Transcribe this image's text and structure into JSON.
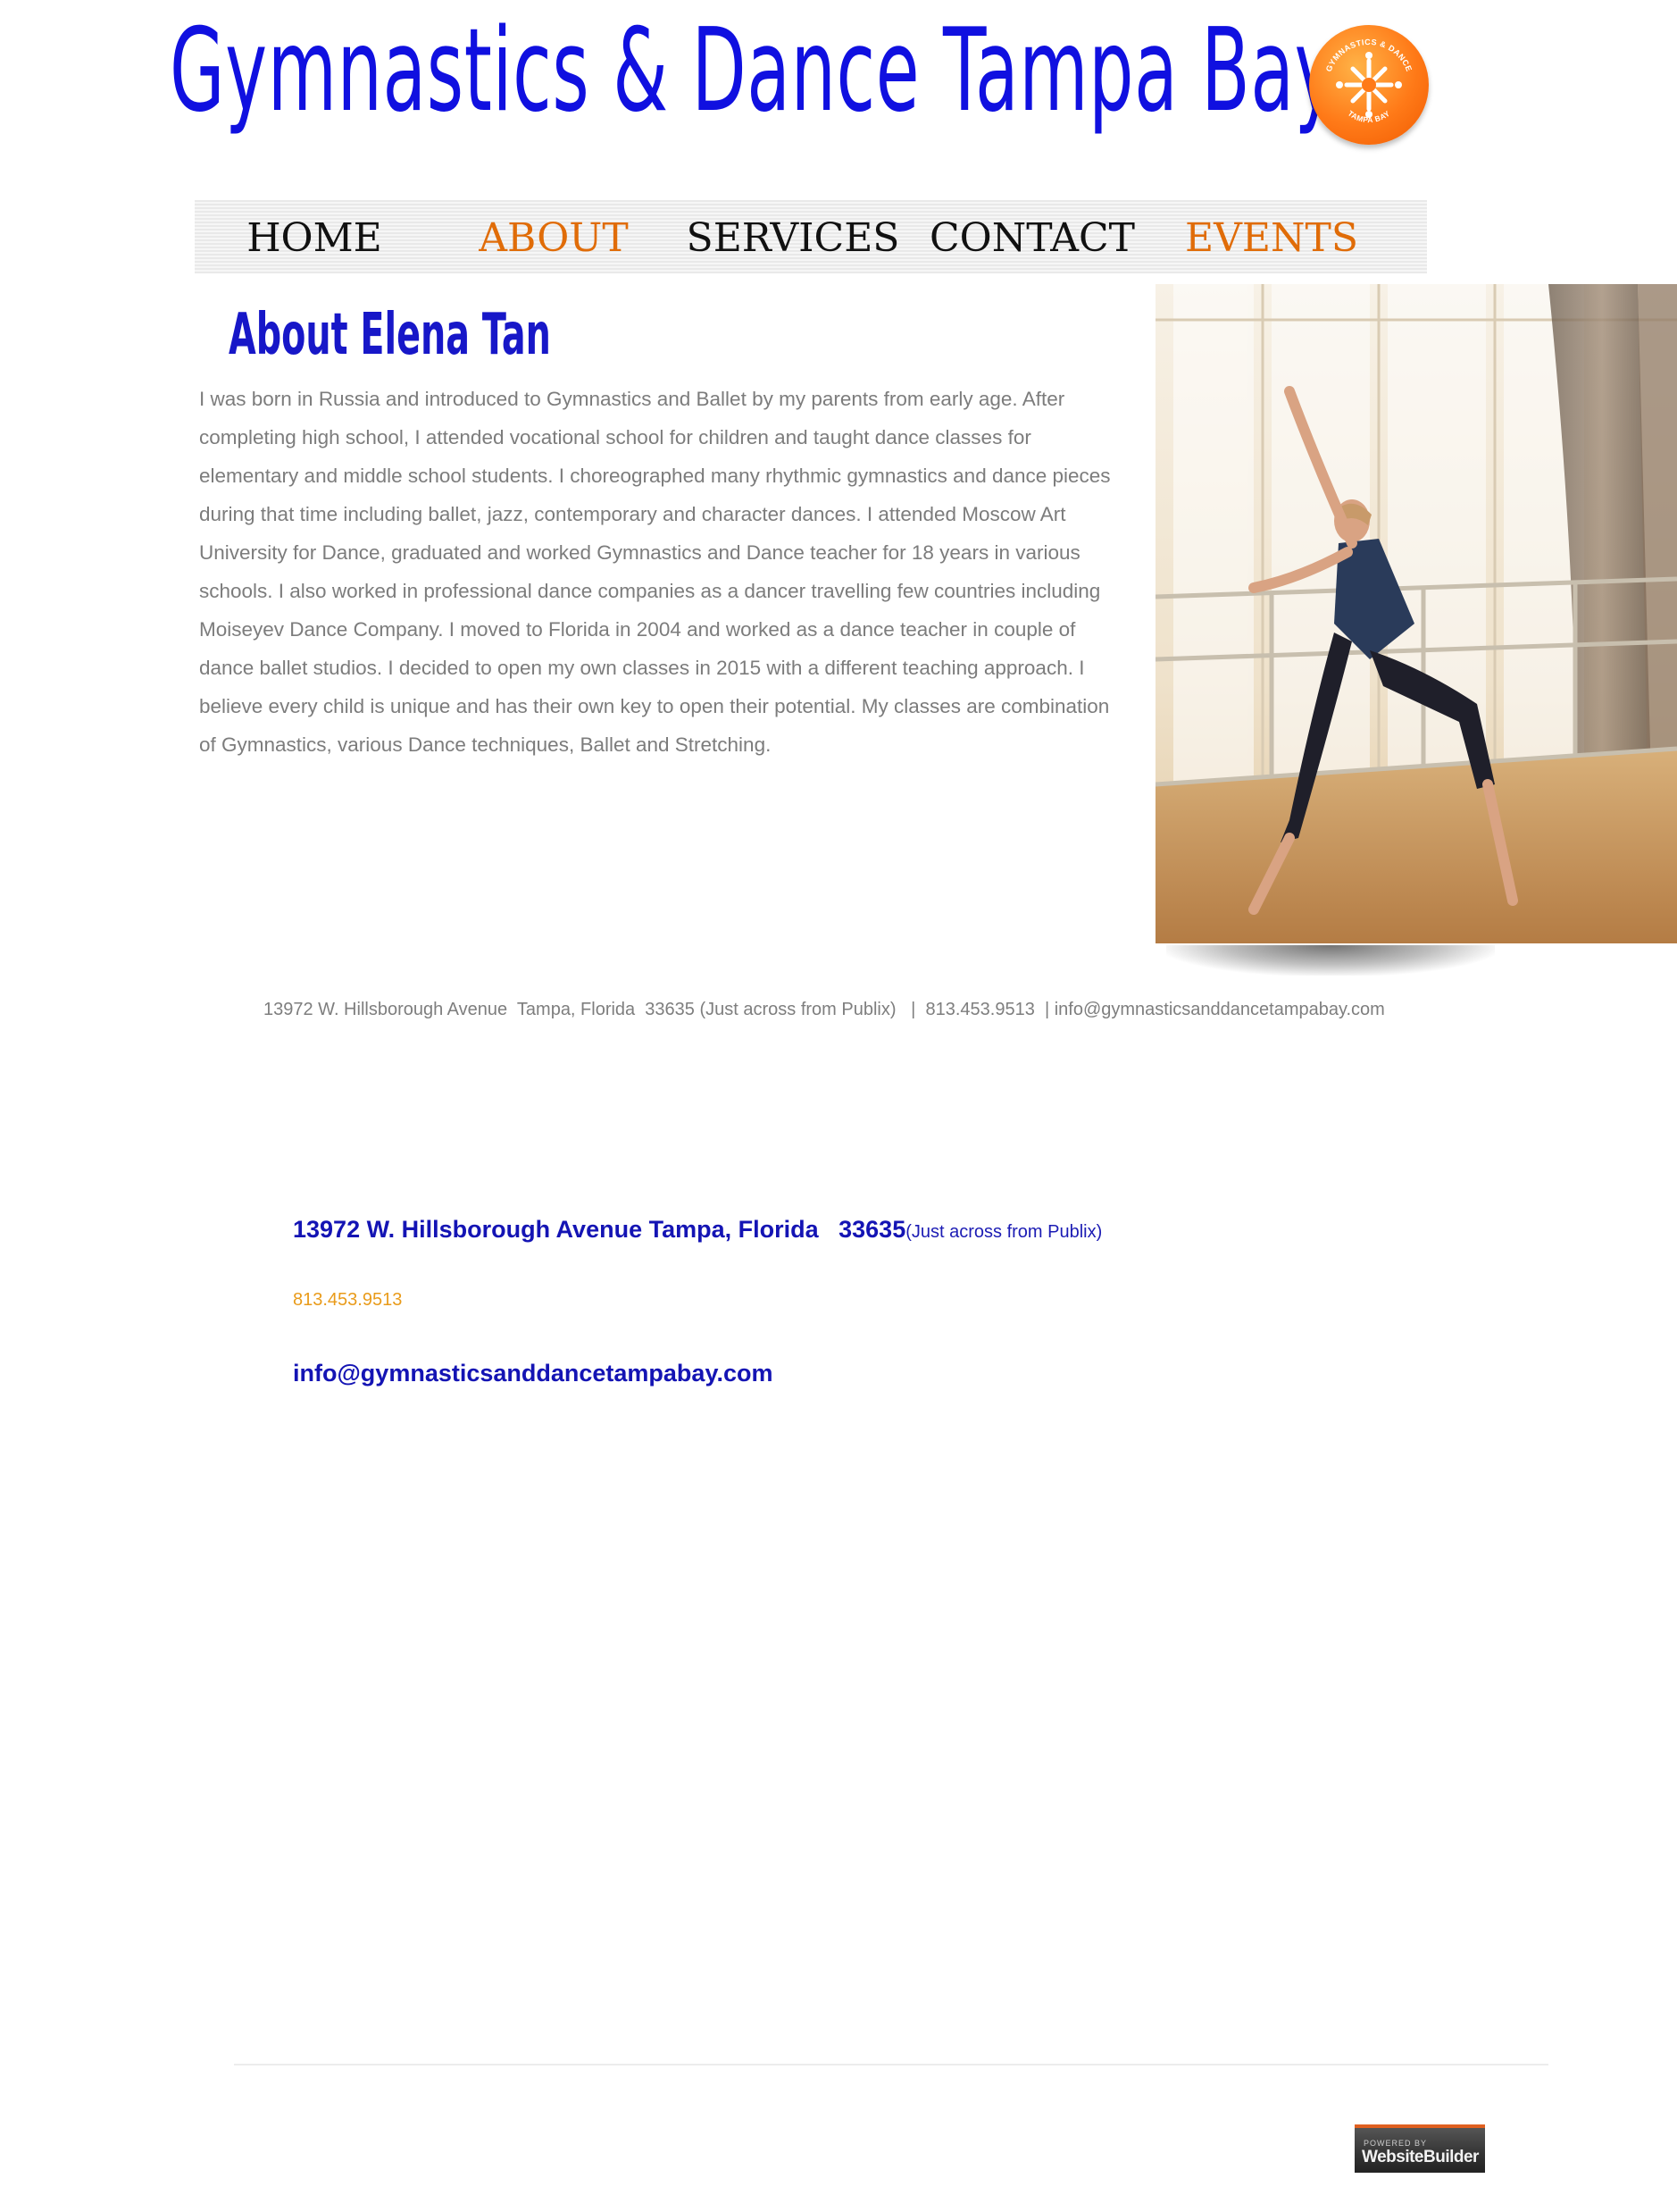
{
  "header": {
    "site_title": "Gymnastics & Dance Tampa Bay",
    "logo": {
      "top_text": "GYMNASTICS & DANCE",
      "bottom_text": "TAMPA BAY",
      "icon": "dancers-star-logo-icon",
      "color": "#ff7a18"
    }
  },
  "nav": {
    "items": [
      {
        "label": "HOME",
        "active": false
      },
      {
        "label": "ABOUT",
        "active": true
      },
      {
        "label": "SERVICES",
        "active": false
      },
      {
        "label": "CONTACT",
        "active": false
      },
      {
        "label": "EVENTS",
        "active": true
      }
    ],
    "active_color": "#e06c08"
  },
  "about": {
    "heading": "About  Elena Tan",
    "bio": "I was born in Russia and introduced to Gymnastics and Ballet by my parents from early age. After completing high school, I attended vocational school for children and taught dance classes for elementary and middle school students.  I choreographed many rhythmic gymnastics and dance pieces during that time including ballet, jazz, contemporary and character dances.  I attended Moscow Art University for Dance, graduated and worked Gymnastics and Dance teacher for 18 years in various schools. I also worked in professional dance companies as a dancer travelling few countries including Moiseyev Dance Company.  I moved to Florida in 2004 and worked as a dance teacher in couple of dance ballet studios.  I decided to open my own classes in 2015 with a different teaching approach. I believe every child is unique and has their own key to open their potential. My classes are combination of Gymnastics, various Dance techniques, Ballet and Stretching.",
    "photo": "ballet-dancer-at-barre-photo"
  },
  "footer_line": "13972 W. Hillsborough Avenue  Tampa, Florida  33635 (Just across from Publix)   |  813.453.9513  | info@gymnasticsanddancetampabay.com",
  "contact": {
    "address": "13972 W. Hillsborough Avenue Tampa, Florida   33635",
    "address_note": "(Just across from Publix)",
    "phone": "813.453.9513",
    "email": "info@gymnasticsanddancetampabay.com"
  },
  "badge": {
    "small": "POWERED BY",
    "big": "WebsiteBuilder"
  },
  "colors": {
    "title_blue": "#1010e0",
    "heading_blue": "#1717c8",
    "body_gray": "#7c7c7c",
    "phone_orange": "#e99b1a"
  }
}
